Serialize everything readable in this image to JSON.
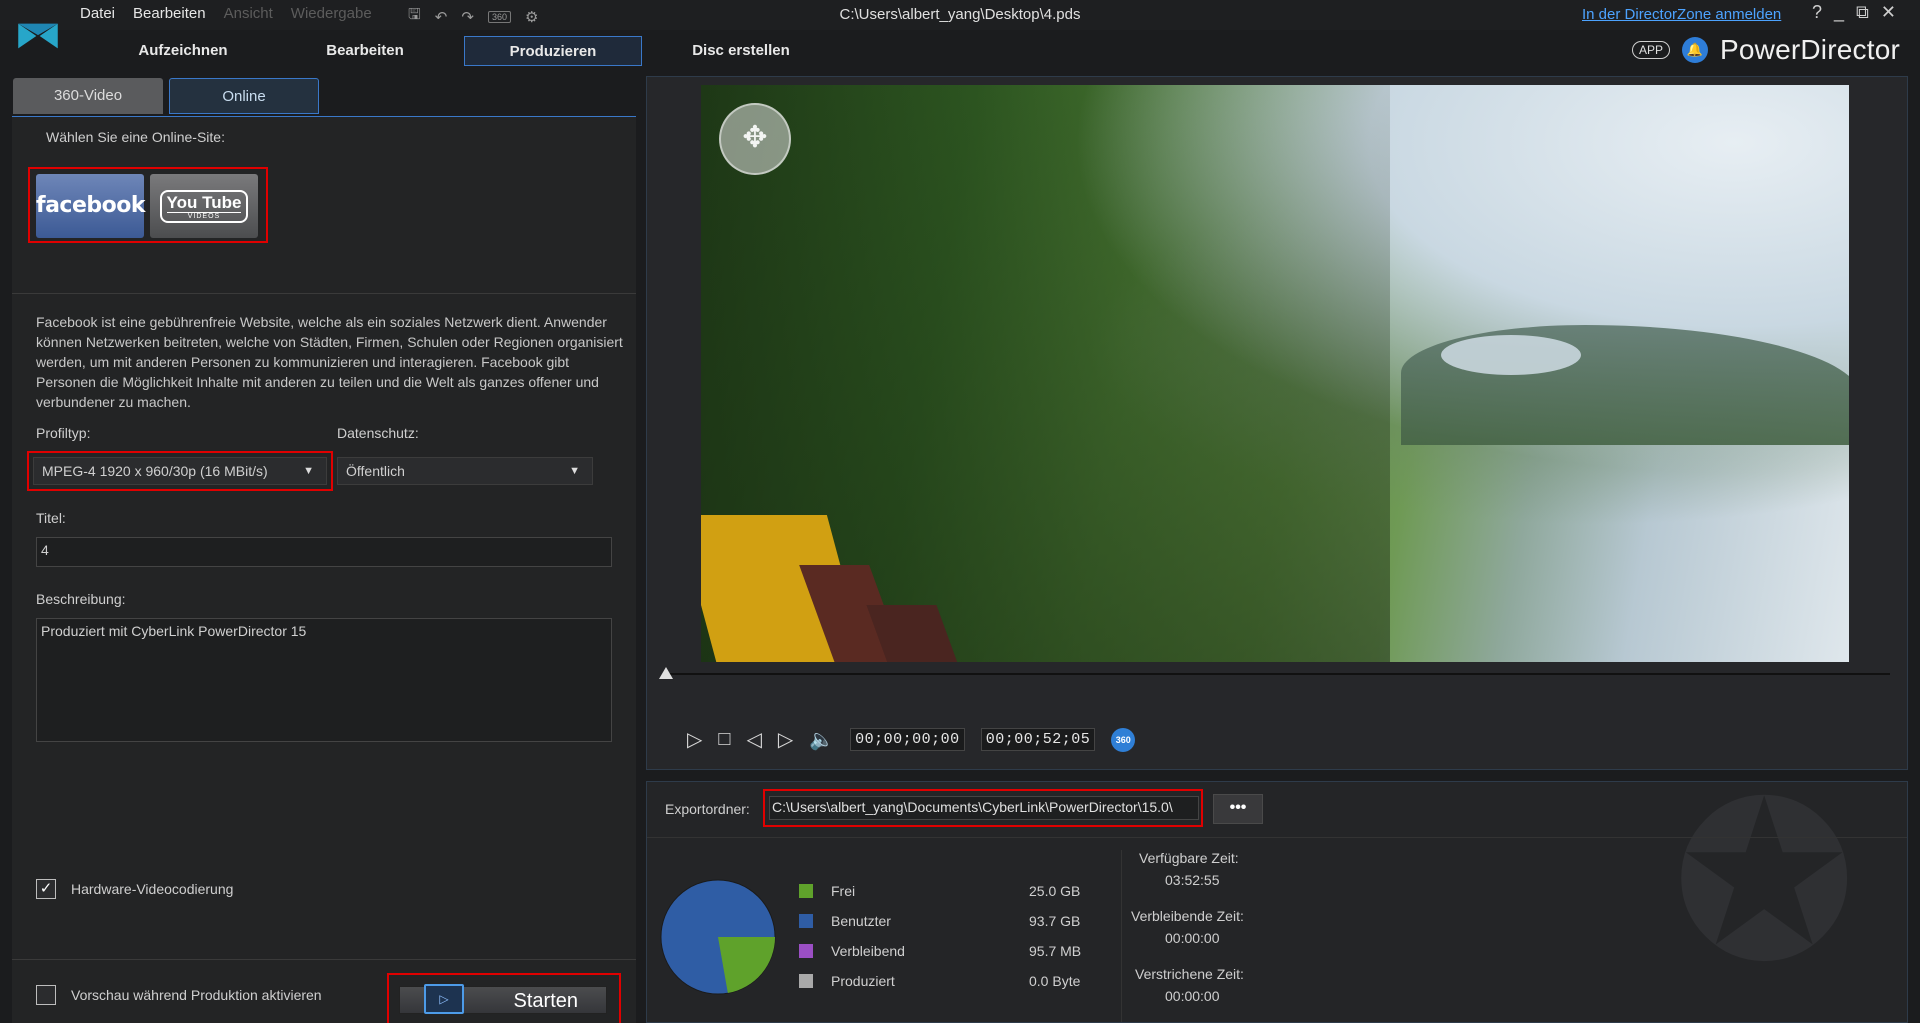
{
  "titlebar": {
    "menu": [
      "Datei",
      "Bearbeiten",
      "Ansicht",
      "Wiedergabe"
    ],
    "project_path": "C:\\Users\\albert_yang\\Desktop\\4.pds",
    "directorzone_link": "In der DirectorZone anmelden",
    "help": "?",
    "minimize": "_",
    "restore": "⧉",
    "close": "✕",
    "badge_360": "360"
  },
  "modes": [
    "Aufzeichnen",
    "Bearbeiten",
    "Produzieren",
    "Disc erstellen"
  ],
  "active_mode": "Produzieren",
  "brand": {
    "app_pill": "APP",
    "name": "PowerDirector"
  },
  "subtabs": [
    "360-Video",
    "Online"
  ],
  "online": {
    "choose_site_label": "Wählen Sie eine Online-Site:",
    "sites": {
      "facebook": "facebook",
      "youtube_top": "You Tube",
      "youtube_bottom": "VIDEOS"
    },
    "description": "Facebook ist eine gebührenfreie Website, welche als ein soziales Netzwerk dient. Anwender können Netzwerken beitreten, welche von Städten, Firmen, Schulen oder Regionen organisiert werden, um mit anderen Personen zu kommunizieren und interagieren. Facebook gibt Personen die Möglichkeit Inhalte mit anderen zu teilen und die Welt als ganzes offener und verbundener zu machen.",
    "profile_label": "Profiltyp:",
    "profile_value": "MPEG-4 1920 x 960/30p (16 MBit/s)",
    "privacy_label": "Datenschutz:",
    "privacy_value": "Öffentlich",
    "title_label": "Titel:",
    "title_value": "4",
    "description_label": "Beschreibung:",
    "description_value": "Produziert mit CyberLink PowerDirector 15",
    "hw_encoding_label": "Hardware-Videocodierung",
    "hw_encoding_checked": true,
    "preview_label": "Vorschau während Produktion aktivieren",
    "preview_checked": false,
    "start_label": "Starten"
  },
  "player": {
    "time_current": "00;00;00;00",
    "time_total": "00;00;52;05",
    "btn_360": "360",
    "progress": 0
  },
  "export": {
    "folder_label": "Exportordner:",
    "folder_value": "C:\\Users\\albert_yang\\Documents\\CyberLink\\PowerDirector\\15.0\\",
    "more_label": "•••",
    "legend": [
      {
        "name": "Frei",
        "value": "25.0  GB",
        "color": "#5fa22b"
      },
      {
        "name": "Benutzter",
        "value": "93.7  GB",
        "color": "#2f5da5"
      },
      {
        "name": "Verbleibend",
        "value": "95.7  MB",
        "color": "#9b4fc4"
      },
      {
        "name": "Produziert",
        "value": "0.0  Byte",
        "color": "#a9a9a9"
      }
    ],
    "available_time_label": "Verfügbare Zeit:",
    "available_time": "03:52:55",
    "remaining_time_label": "Verbleibende Zeit:",
    "remaining_time": "00:00:00",
    "elapsed_time_label": "Verstrichene Zeit:",
    "elapsed_time": "00:00:00"
  }
}
